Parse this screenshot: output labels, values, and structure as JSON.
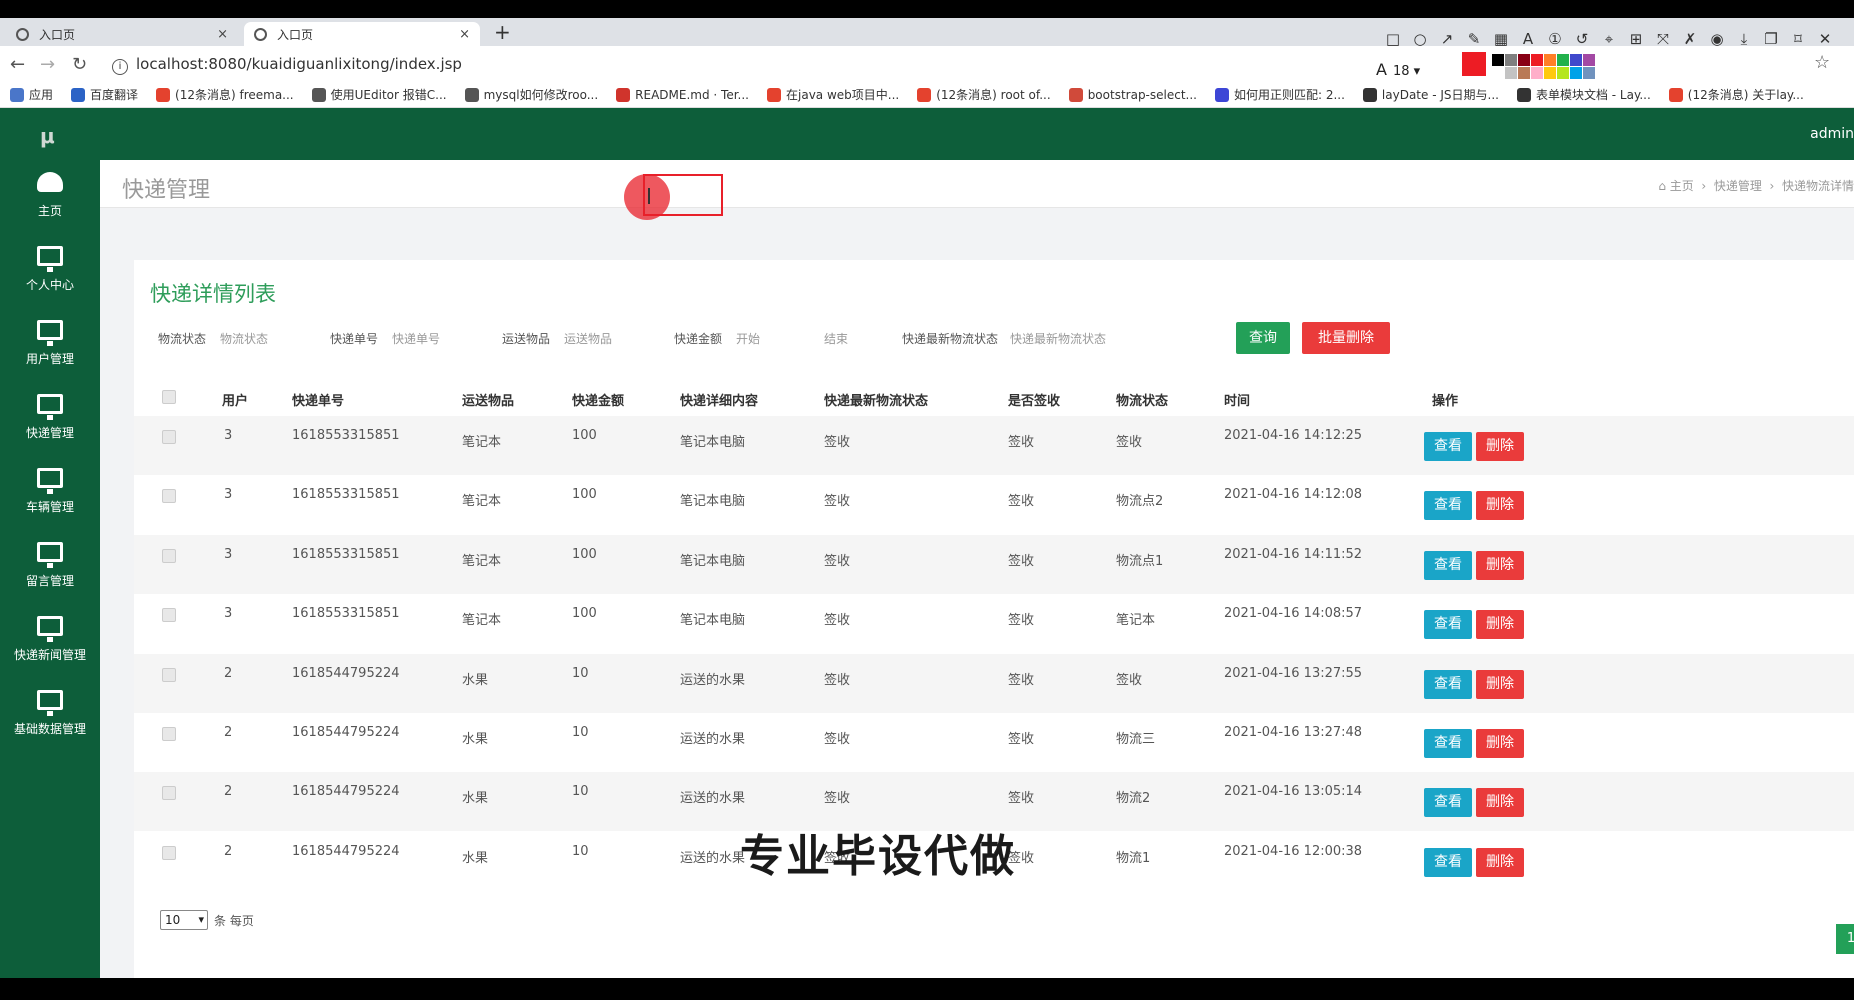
{
  "browser": {
    "tabs": [
      {
        "label": "入口页",
        "close": "×"
      },
      {
        "label": "入口页",
        "close": "×"
      }
    ],
    "new_tab": "+",
    "back_icon": "←",
    "forward_icon": "→",
    "reload_icon": "↻",
    "url": "localhost:8080/kuaidiguanlixitong/index.jsp",
    "font_size": "18",
    "star_icon": "☆",
    "bookmarks": [
      {
        "label": "应用",
        "color": "#4a76c9"
      },
      {
        "label": "百度翻译",
        "color": "#2b63c6"
      },
      {
        "label": "(12条消息) freema...",
        "color": "#e4422e"
      },
      {
        "label": "使用UEditor 报错C...",
        "color": "#555555"
      },
      {
        "label": "mysql如何修改roo...",
        "color": "#555555"
      },
      {
        "label": "README.md · Ter...",
        "color": "#d0342c"
      },
      {
        "label": "在java web项目中...",
        "color": "#e4422e"
      },
      {
        "label": "(12条消息) root of...",
        "color": "#e4422e"
      },
      {
        "label": "bootstrap-select...",
        "color": "#d04a3a"
      },
      {
        "label": "如何用正则匹配: 2...",
        "color": "#3d46d6"
      },
      {
        "label": "layDate - JS日期与...",
        "color": "#333333"
      },
      {
        "label": "表单模块文档 - Lay...",
        "color": "#333333"
      },
      {
        "label": "(12条消息) 关于lay...",
        "color": "#e4422e"
      }
    ],
    "palette": [
      "#000000",
      "#7f7f7f",
      "#880015",
      "#ed1c24",
      "#ff7f27",
      "#22b14c",
      "#3f48cc",
      "#a349a4",
      "#ffffff",
      "#c3c3c3",
      "#b97a57",
      "#ffaec9",
      "#ffc90e",
      "#b5e61d",
      "#00a2e8",
      "#7092be"
    ],
    "selected_color": "#ed1c24"
  },
  "app": {
    "logo": "μ",
    "user": "admin",
    "sidebar": [
      {
        "label": "主页",
        "icon": "dashboard-icon"
      },
      {
        "label": "个人中心",
        "icon": "monitor-icon"
      },
      {
        "label": "用户管理",
        "icon": "monitor-icon"
      },
      {
        "label": "快递管理",
        "icon": "monitor-icon"
      },
      {
        "label": "车辆管理",
        "icon": "monitor-icon"
      },
      {
        "label": "留言管理",
        "icon": "monitor-icon"
      },
      {
        "label": "快递新闻管理",
        "icon": "monitor-icon"
      },
      {
        "label": "基础数据管理",
        "icon": "monitor-icon"
      }
    ],
    "page_title": "快递管理",
    "breadcrumb": [
      "主页",
      "快递管理",
      "快递物流详情"
    ],
    "card_title": "快递详情列表",
    "filters": [
      {
        "label": "物流状态",
        "placeholder": "物流状态"
      },
      {
        "label": "快递单号",
        "placeholder": "快递单号"
      },
      {
        "label": "运送物品",
        "placeholder": "运送物品"
      },
      {
        "label": "快递金额",
        "placeholder": "开始"
      },
      {
        "label": "",
        "placeholder": "结束"
      },
      {
        "label": "快递最新物流状态",
        "placeholder": "快递最新物流状态"
      }
    ],
    "query_btn": "查询",
    "batch_delete_btn": "批量删除",
    "columns": [
      "用户",
      "快递单号",
      "运送物品",
      "快递金额",
      "快递详细内容",
      "快递最新物流状态",
      "是否签收",
      "物流状态",
      "时间",
      "操作"
    ],
    "rows": [
      [
        "3",
        "1618553315851",
        "笔记本",
        "100",
        "笔记本电脑",
        "签收",
        "签收",
        "签收",
        "2021-04-16 14:12:25"
      ],
      [
        "3",
        "1618553315851",
        "笔记本",
        "100",
        "笔记本电脑",
        "签收",
        "签收",
        "物流点2",
        "2021-04-16 14:12:08"
      ],
      [
        "3",
        "1618553315851",
        "笔记本",
        "100",
        "笔记本电脑",
        "签收",
        "签收",
        "物流点1",
        "2021-04-16 14:11:52"
      ],
      [
        "3",
        "1618553315851",
        "笔记本",
        "100",
        "笔记本电脑",
        "签收",
        "签收",
        "笔记本",
        "2021-04-16 14:08:57"
      ],
      [
        "2",
        "1618544795224",
        "水果",
        "10",
        "运送的水果",
        "签收",
        "签收",
        "签收",
        "2021-04-16 13:27:55"
      ],
      [
        "2",
        "1618544795224",
        "水果",
        "10",
        "运送的水果",
        "签收",
        "签收",
        "物流三",
        "2021-04-16 13:27:48"
      ],
      [
        "2",
        "1618544795224",
        "水果",
        "10",
        "运送的水果",
        "签收",
        "签收",
        "物流2",
        "2021-04-16 13:05:14"
      ],
      [
        "2",
        "1618544795224",
        "水果",
        "10",
        "运送的水果",
        "签收",
        "签收",
        "物流1",
        "2021-04-16 12:00:38"
      ]
    ],
    "view_btn": "查看",
    "delete_btn": "删除",
    "page_size": "10",
    "page_size_suffix": "条 每页",
    "current_page": "1"
  },
  "watermark": "专业毕设代做"
}
